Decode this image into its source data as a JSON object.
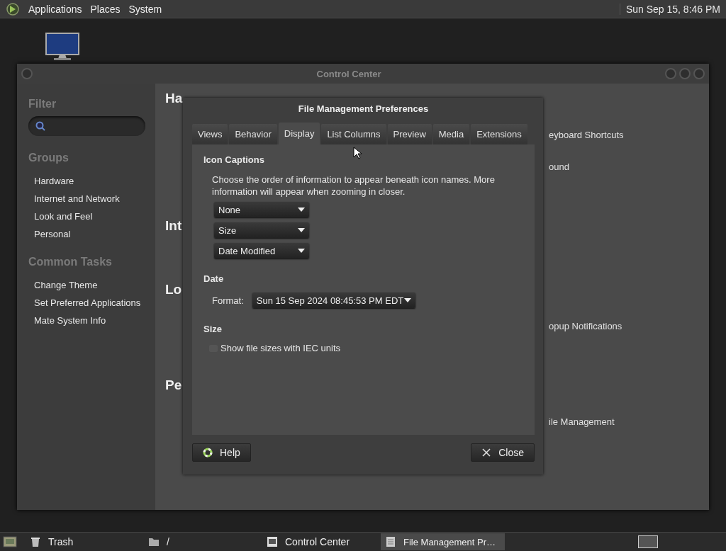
{
  "top_panel": {
    "menus": [
      "Applications",
      "Places",
      "System"
    ],
    "clock": "Sun Sep 15,  8:46 PM"
  },
  "control_center": {
    "title": "Control Center",
    "sidebar": {
      "filter_heading": "Filter",
      "groups_heading": "Groups",
      "groups": [
        "Hardware",
        "Internet and Network",
        "Look and Feel",
        "Personal"
      ],
      "tasks_heading": "Common Tasks",
      "tasks": [
        "Change Theme",
        "Set Preferred Applications",
        "Mate System Info"
      ]
    },
    "section_headings": [
      "Ha",
      "Int",
      "Lo",
      "Pe"
    ],
    "items": [
      "eyboard Shortcuts",
      "ound",
      "opup Notifications",
      "ile Management"
    ]
  },
  "dialog": {
    "title": "File Management Preferences",
    "tabs": [
      {
        "label": "Views",
        "selected": false
      },
      {
        "label": "Behavior",
        "selected": false
      },
      {
        "label": "Display",
        "selected": true
      },
      {
        "label": "List Columns",
        "selected": false
      },
      {
        "label": "Preview",
        "selected": false
      },
      {
        "label": "Media",
        "selected": false
      },
      {
        "label": "Extensions",
        "selected": false
      }
    ],
    "icon_captions": {
      "heading": "Icon Captions",
      "description": "Choose the order of information to appear beneath icon names. More information will appear when zooming in closer.",
      "dropdowns": [
        "None",
        "Size",
        "Date Modified"
      ]
    },
    "date": {
      "heading": "Date",
      "format_label": "Format:",
      "format_value": "Sun 15 Sep 2024 08:45:53 PM EDT"
    },
    "size": {
      "heading": "Size",
      "checkbox": {
        "label": "Show file sizes with IEC units",
        "checked": false
      }
    },
    "buttons": [
      {
        "kind": "help",
        "label": "Help"
      },
      {
        "kind": "close",
        "label": "Close"
      }
    ]
  },
  "taskbar": {
    "items": [
      {
        "kind": "trash",
        "label": "Trash",
        "selected": false
      },
      {
        "kind": "folder",
        "label": "/",
        "selected": false
      },
      {
        "kind": "control",
        "label": "Control Center",
        "selected": false
      },
      {
        "kind": "prefs",
        "label": "File Management Pr…",
        "selected": true
      }
    ]
  }
}
